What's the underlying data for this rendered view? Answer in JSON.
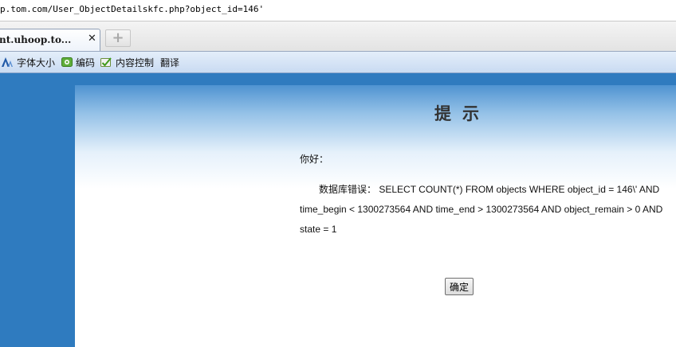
{
  "browser": {
    "address": "p.tom.com/User_ObjectDetailskfc.php?object_id=146'",
    "tab": {
      "title": "nt.uhoop.to...",
      "close": "✕"
    },
    "new_tab": "+"
  },
  "toolbar": {
    "items": [
      {
        "label": "字体大小",
        "icon": "font-size-icon"
      },
      {
        "label": "编码",
        "icon": "encoding-icon"
      },
      {
        "label": "内容控制",
        "icon": "content-control-icon"
      },
      {
        "label": "翻译"
      }
    ]
  },
  "page": {
    "title": "提示",
    "greeting": "你好：",
    "error_label": "数据库错误：",
    "error_text": "SELECT COUNT(*) FROM objects WHERE object_id = 146\\' AND time_begin < 1300273564 AND time_end > 1300273564 AND object_remain > 0 AND state = 1",
    "ok_button": "确定"
  },
  "colors": {
    "page_blue": "#2f7bbf",
    "toolbar_blue": "#c9dbf2"
  }
}
